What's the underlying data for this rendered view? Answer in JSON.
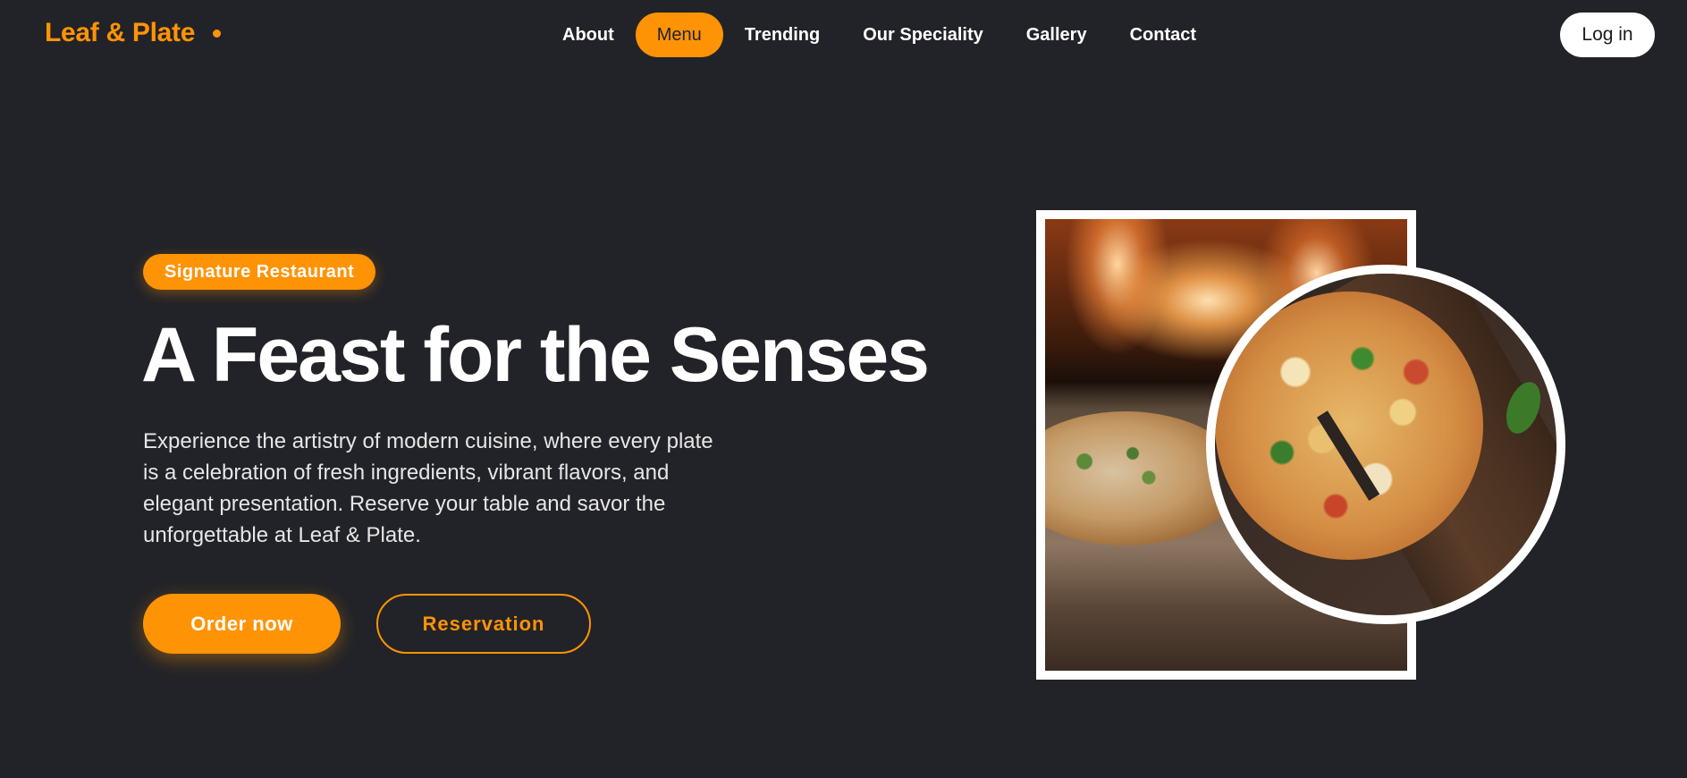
{
  "brand": {
    "name": "Leaf & Plate",
    "accent_color": "#ff9306",
    "background_color": "#222328"
  },
  "nav": {
    "items": [
      {
        "label": "About",
        "active": false
      },
      {
        "label": "Menu",
        "active": true
      },
      {
        "label": "Trending",
        "active": false
      },
      {
        "label": "Our Speciality",
        "active": false
      },
      {
        "label": "Gallery",
        "active": false
      },
      {
        "label": "Contact",
        "active": false
      }
    ],
    "login_label": "Log in"
  },
  "hero": {
    "badge": "Signature Restaurant",
    "title": "A Feast for the Senses",
    "description": "Experience the artistry of modern cuisine, where every plate is a celebration of fresh ingredients, vibrant flavors, and elegant presentation. Reserve your table and savor the unforgettable at Leaf & Plate.",
    "primary_button": "Order now",
    "secondary_button": "Reservation"
  }
}
